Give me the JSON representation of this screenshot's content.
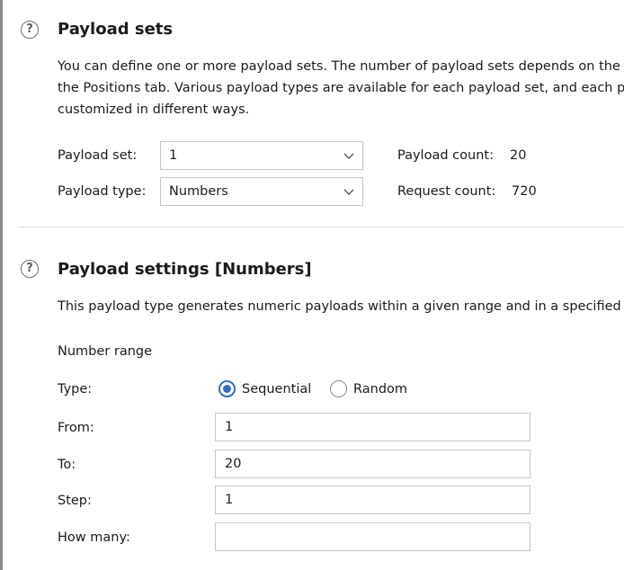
{
  "payload_sets": {
    "title": "Payload sets",
    "description_lines": [
      "You can define one or more payload sets. The number of payload sets depends on the attack type defined in",
      "the Positions tab. Various payload types are available for each payload set, and each payload type can be",
      "customized in different ways."
    ],
    "payload_set_label": "Payload set:",
    "payload_set_value": "1",
    "payload_type_label": "Payload type:",
    "payload_type_value": "Numbers",
    "payload_count_label": "Payload count:",
    "payload_count_value": "20",
    "request_count_label": "Request count:",
    "request_count_value": "720"
  },
  "payload_settings": {
    "title": "Payload settings [Numbers]",
    "description": "This payload type generates numeric payloads within a given range and in a specified format.",
    "number_range_label": "Number range",
    "type_label": "Type:",
    "type_options": [
      "Sequential",
      "Random"
    ],
    "type_selected": "Sequential",
    "from_label": "From:",
    "from_value": "1",
    "to_label": "To:",
    "to_value": "20",
    "step_label": "Step:",
    "step_value": "1",
    "how_many_label": "How many:",
    "how_many_value": ""
  },
  "icons": {
    "help": "help-circle-icon",
    "dropdown": "chevron-down-icon"
  },
  "colors": {
    "accent": "#2e6fc3",
    "border": "#c5c5c5",
    "divider": "#d8d8d8",
    "text": "#1b1b1b"
  }
}
